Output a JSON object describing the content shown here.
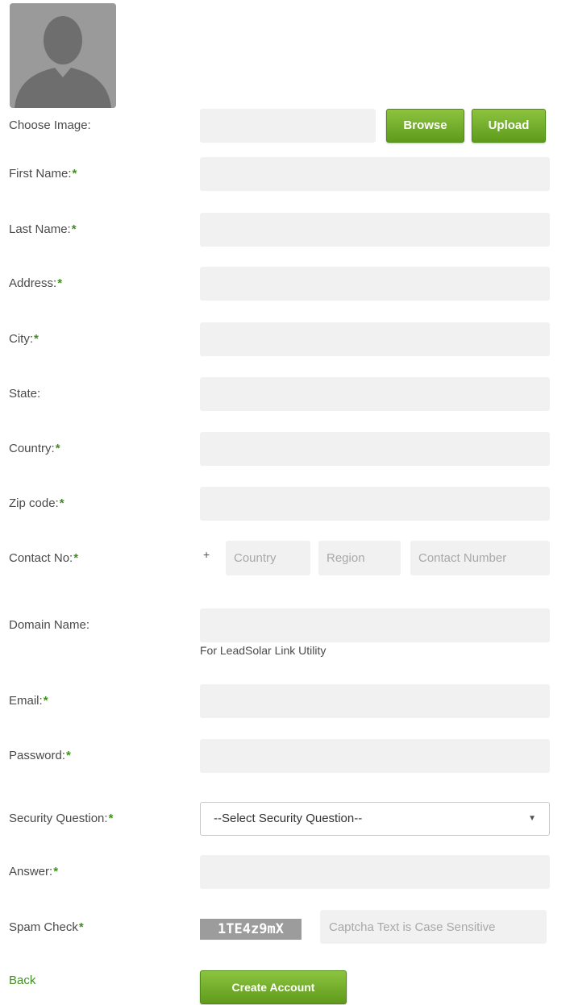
{
  "photo": {
    "choose_label": "Choose Image:",
    "browse_label": "Browse",
    "upload_label": "Upload"
  },
  "form": {
    "first_name_label": "First Name:",
    "last_name_label": "Last Name:",
    "address_label": "Address:",
    "city_label": "City:",
    "state_label": "State:",
    "country_label": "Country:",
    "zip_label": "Zip code:",
    "contact_label": "Contact No:",
    "contact_plus": "+",
    "contact_country_placeholder": "Country",
    "contact_region_placeholder": "Region",
    "contact_number_placeholder": "Contact Number",
    "domain_label": "Domain Name:",
    "domain_hint": "For LeadSolar Link Utility",
    "email_label": "Email:",
    "password_label": "Password:",
    "security_question_label": "Security Question:",
    "security_question_selected": "--Select Security Question--",
    "answer_label": "Answer:",
    "spam_check_label": "Spam Check",
    "captcha_text": "1TE4z9mX",
    "captcha_placeholder": "Captcha Text is Case Sensitive",
    "required_mark": "*"
  },
  "actions": {
    "back_label": "Back",
    "create_label": "Create Account"
  },
  "colors": {
    "accent_green": "#6aa62a",
    "field_bg": "#f1f1f1"
  }
}
